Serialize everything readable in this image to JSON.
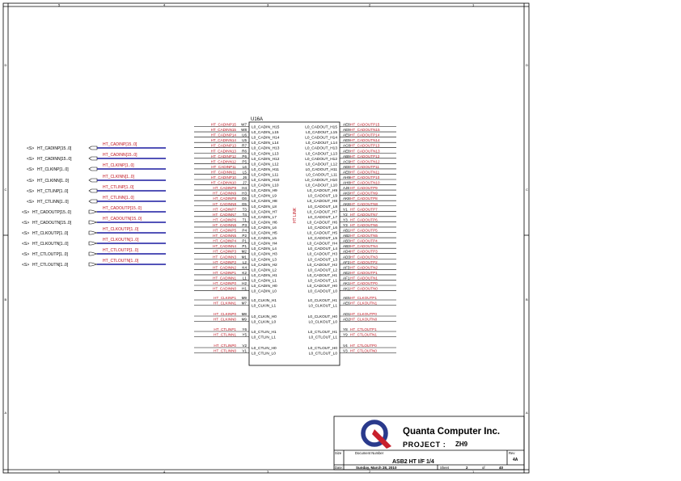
{
  "border": {
    "top_cols": [
      "5",
      "4",
      "3",
      "2",
      "1"
    ],
    "side_rows": [
      "D",
      "C",
      "B",
      "A"
    ]
  },
  "title_block": {
    "company": "Quanta Computer Inc.",
    "project_label": "PROJECT :",
    "project_value": "ZH9",
    "size_label": "Size",
    "docnum_label": "Document Number",
    "rev_label": "Rev",
    "docnum": "ASB2 HT I/F 1/4",
    "rev": "4A",
    "date_label": "Date:",
    "date": "Sunday, March 28, 2010",
    "sheet_label": "Sheet",
    "sheet": "2",
    "of_label": "of",
    "total": "40"
  },
  "ports": [
    {
      "dir": "<S>",
      "name": "HT_CADINP[15..0]",
      "bus": "HT_CADINP[15..0]",
      "out": false
    },
    {
      "dir": "<S>",
      "name": "HT_CADINN[15..0]",
      "bus": "HT_CADINN[15..0]",
      "out": false
    },
    {
      "dir": "<S>",
      "name": "HT_CLKINP[1..0]",
      "bus": "HT_CLKINP[1..0]",
      "out": false
    },
    {
      "dir": "<S>",
      "name": "HT_CLKINN[1..0]",
      "bus": "HT_CLKINN[1..0]",
      "out": false
    },
    {
      "dir": "<S>",
      "name": "HT_CTLINP[1..0]",
      "bus": "HT_CTLINP[1..0]",
      "out": false
    },
    {
      "dir": "<S>",
      "name": "HT_CTLINN[1..0]",
      "bus": "HT_CTLINN[1..0]",
      "out": false
    },
    {
      "dir": "<S>",
      "name": "HT_CADOUTP[15..0]",
      "bus": "HT_CADOUTP[15..0]",
      "out": true
    },
    {
      "dir": "<S>",
      "name": "HT_CADOUTN[15..0]",
      "bus": "HT_CADOUTN[15..0]",
      "out": true
    },
    {
      "dir": "<S>",
      "name": "HT_CLKOUTP[1..0]",
      "bus": "HT_CLKOUTP[1..0]",
      "out": true
    },
    {
      "dir": "<S>",
      "name": "HT_CLKOUTN[1..0]",
      "bus": "HT_CLKOUTN[1..0]",
      "out": true
    },
    {
      "dir": "<S>",
      "name": "HT_CTLOUTP[1..0]",
      "bus": "HT_CTLOUTP[1..0]",
      "out": true
    },
    {
      "dir": "<S>",
      "name": "HT_CTLOUTN[1..0]",
      "bus": "HT_CTLOUTN[1..0]",
      "out": true
    }
  ],
  "chip": {
    "ref": "U16A",
    "center_label": "HT LINK",
    "left_cad": [
      {
        "net": "HT_CADINP15",
        "pin": "W7",
        "label": "L0_CADIN_H15"
      },
      {
        "net": "HT_CADINN15",
        "pin": "W8",
        "label": "L0_CADIN_L15"
      },
      {
        "net": "HT_CADINP14",
        "pin": "U6",
        "label": "L0_CADIN_H14"
      },
      {
        "net": "HT_CADINN14",
        "pin": "U5",
        "label": "L0_CADIN_L14"
      },
      {
        "net": "HT_CADINP13",
        "pin": "R7",
        "label": "L0_CADIN_H13"
      },
      {
        "net": "HT_CADINN13",
        "pin": "R6",
        "label": "L0_CADIN_L13"
      },
      {
        "net": "HT_CADINP12",
        "pin": "P6",
        "label": "L0_CADIN_H12"
      },
      {
        "net": "HT_CADINN12",
        "pin": "P5",
        "label": "L0_CADIN_L12"
      },
      {
        "net": "HT_CADINP11",
        "pin": "L6",
        "label": "L0_CADIN_H11"
      },
      {
        "net": "HT_CADINN11",
        "pin": "L5",
        "label": "L0_CADIN_L11"
      },
      {
        "net": "HT_CADINP10",
        "pin": "J6",
        "label": "L0_CADIN_H10"
      },
      {
        "net": "HT_CADINN10",
        "pin": "J7",
        "label": "L0_CADIN_L10"
      },
      {
        "net": "HT_CADINP9",
        "pin": "H4",
        "label": "L0_CADIN_H9"
      },
      {
        "net": "HT_CADINN9",
        "pin": "H3",
        "label": "L0_CADIN_L9"
      },
      {
        "net": "HT_CADINP8",
        "pin": "G6",
        "label": "L0_CADIN_H8"
      },
      {
        "net": "HT_CADINN8",
        "pin": "G5",
        "label": "L0_CADIN_L8"
      },
      {
        "net": "HT_CADINP7",
        "pin": "T3",
        "label": "L0_CADIN_H7"
      },
      {
        "net": "HT_CADINN7",
        "pin": "T4",
        "label": "L0_CADIN_L7"
      },
      {
        "net": "HT_CADINP6",
        "pin": "T1",
        "label": "L0_CADIN_H6"
      },
      {
        "net": "HT_CADINN6",
        "pin": "P3",
        "label": "L0_CADIN_L6"
      },
      {
        "net": "HT_CADINP5",
        "pin": "P4",
        "label": "L0_CADIN_H5"
      },
      {
        "net": "HT_CADINN5",
        "pin": "P2",
        "label": "L0_CADIN_L5"
      },
      {
        "net": "HT_CADINP4",
        "pin": "P1",
        "label": "L0_CADIN_H4"
      },
      {
        "net": "HT_CADINN4",
        "pin": "P1",
        "label": "L0_CADIN_L4"
      },
      {
        "net": "HT_CADINP3",
        "pin": "M2",
        "label": "L0_CADIN_H3"
      },
      {
        "net": "HT_CADINN3",
        "pin": "M1",
        "label": "L0_CADIN_L3"
      },
      {
        "net": "HT_CADINP2",
        "pin": "L2",
        "label": "L0_CADIN_H2"
      },
      {
        "net": "HT_CADINN2",
        "pin": "K4",
        "label": "L0_CADIN_L2"
      },
      {
        "net": "HT_CADINP1",
        "pin": "K2",
        "label": "L0_CADIN_H1"
      },
      {
        "net": "HT_CADINN1",
        "pin": "L1",
        "label": "L0_CADIN_L1"
      },
      {
        "net": "HT_CADINP0",
        "pin": "H2",
        "label": "L0_CADIN_H0"
      },
      {
        "net": "HT_CADINN0",
        "pin": "H1",
        "label": "L0_CADIN_L0"
      }
    ],
    "right_cad": [
      {
        "net": "HT_CADOUTP15",
        "pin": "AE8",
        "label": "L0_CADOUT_H15"
      },
      {
        "net": "HT_CADOUTN15",
        "pin": "AE9",
        "label": "L0_CADOUT_L15"
      },
      {
        "net": "HT_CADOUTP14",
        "pin": "AE9",
        "label": "L0_CADOUT_H14"
      },
      {
        "net": "HT_CADOUTN14",
        "pin": "AE9",
        "label": "L0_CADOUT_L14"
      },
      {
        "net": "HT_CADOUTP13",
        "pin": "AC8",
        "label": "L0_CADOUT_H13"
      },
      {
        "net": "HT_CADOUTN13",
        "pin": "AE8",
        "label": "L0_CADOUT_L13"
      },
      {
        "net": "HT_CADOUTP12",
        "pin": "AB9",
        "label": "L0_CADOUT_H12"
      },
      {
        "net": "HT_CADOUTN12",
        "pin": "AC9",
        "label": "L0_CADOUT_L12"
      },
      {
        "net": "HT_CADOUTP11",
        "pin": "AE8",
        "label": "L0_CADOUT_H11"
      },
      {
        "net": "HT_CADOUTN11",
        "pin": "AE8",
        "label": "L0_CADOUT_L11"
      },
      {
        "net": "HT_CADOUTP10",
        "pin": "AH9",
        "label": "L0_CADOUT_H10"
      },
      {
        "net": "HT_CADOUTN10",
        "pin": "AH8",
        "label": "L0_CADOUT_L10"
      },
      {
        "net": "HT_CADOUTP9",
        "pin": "AJ8",
        "label": "L0_CADOUT_H9"
      },
      {
        "net": "HT_CADOUTN9",
        "pin": "AK9",
        "label": "L0_CADOUT_L9"
      },
      {
        "net": "HT_CADOUTP8",
        "pin": "AK8",
        "label": "L0_CADOUT_H8"
      },
      {
        "net": "HT_CADOUTN8",
        "pin": "AK8",
        "label": "L0_CADOUT_L8"
      },
      {
        "net": "HT_CADOUTP7",
        "pin": "V1",
        "label": "L0_CADOUT_H7"
      },
      {
        "net": "HT_CADOUTN7",
        "pin": "Y2",
        "label": "L0_CADOUT_L7"
      },
      {
        "net": "HT_CADOUTP6",
        "pin": "Y3",
        "label": "L0_CADOUT_H6"
      },
      {
        "net": "HT_CADOUTN6",
        "pin": "Y3",
        "label": "L0_CADOUT_L6"
      },
      {
        "net": "HT_CADOUTP5",
        "pin": "AB1",
        "label": "L0_CADOUT_H5"
      },
      {
        "net": "HT_CADOUTN5",
        "pin": "AB2",
        "label": "L0_CADOUT_L5"
      },
      {
        "net": "HT_CADOUTP4",
        "pin": "AB3",
        "label": "L0_CADOUT_H4"
      },
      {
        "net": "HT_CADOUTN4",
        "pin": "AB3",
        "label": "L0_CADOUT_L4"
      },
      {
        "net": "HT_CADOUTP3",
        "pin": "AD4",
        "label": "L0_CADOUT_H3"
      },
      {
        "net": "HT_CADOUTN3",
        "pin": "AD3",
        "label": "L0_CADOUT_L3"
      },
      {
        "net": "HT_CADOUTP2",
        "pin": "AF2",
        "label": "L0_CADOUT_H2"
      },
      {
        "net": "HT_CADOUTN2",
        "pin": "AF3",
        "label": "L0_CADOUT_L2"
      },
      {
        "net": "HT_CADOUTP1",
        "pin": "AE2",
        "label": "L0_CADOUT_H1"
      },
      {
        "net": "HT_CADOUTN1",
        "pin": "AF1",
        "label": "L0_CADOUT_L1"
      },
      {
        "net": "HT_CADOUTP0",
        "pin": "AK1",
        "label": "L0_CADOUT_H0"
      },
      {
        "net": "HT_CADOUTN0",
        "pin": "AK1",
        "label": "L0_CADOUT_L0"
      }
    ],
    "left_misc": [
      {
        "net": "HT_CLKINP1",
        "pin": "M9",
        "label": "L0_CLKIN_H1",
        "group": 0
      },
      {
        "net": "HT_CLKINN1",
        "pin": "M7",
        "label": "L0_CLKIN_L1",
        "group": 0
      },
      {
        "net": "HT_CLKINP0",
        "pin": "M8",
        "label": "L0_CLKIN_H0",
        "group": 1
      },
      {
        "net": "HT_CLKINN0",
        "pin": "M9",
        "label": "L0_CLKIN_L0",
        "group": 1
      },
      {
        "net": "HT_CTLINP1",
        "pin": "Y6",
        "label": "L0_CTLIN_H1",
        "group": 2
      },
      {
        "net": "HT_CTLINN1",
        "pin": "Y5",
        "label": "L0_CTLIN_L1",
        "group": 2
      },
      {
        "net": "HT_CTLINP0",
        "pin": "V2",
        "label": "L0_CTLIN_H0",
        "group": 3
      },
      {
        "net": "HT_CTLINN0",
        "pin": "V1",
        "label": "L0_CTLIN_L0",
        "group": 3
      }
    ],
    "right_misc": [
      {
        "net": "HT_CLKOUTP1",
        "pin": "AE5",
        "label": "L0_CLKOUT_H1",
        "group": 0
      },
      {
        "net": "HT_CLKOUTN1",
        "pin": "AE6",
        "label": "L0_CLKOUT_L1",
        "group": 0
      },
      {
        "net": "HT_CLKOUTP0",
        "pin": "AD1",
        "label": "L0_CLKOUT_H0",
        "group": 1
      },
      {
        "net": "HT_CLKOUTN0",
        "pin": "AD2",
        "label": "L0_CLKOUT_L0",
        "group": 1
      },
      {
        "net": "HT_CTLOUTP1",
        "pin": "Y8",
        "label": "L0_CTLOUT_H1",
        "group": 2
      },
      {
        "net": "HT_CTLOUTN1",
        "pin": "Y9",
        "label": "L0_CTLOUT_L1",
        "group": 2
      },
      {
        "net": "HT_CTLOUTP0",
        "pin": "V4",
        "label": "L0_CTLOUT_H0",
        "group": 3
      },
      {
        "net": "HT_CTLOUTN0",
        "pin": "V3",
        "label": "L0_CTLOUT_L0",
        "group": 3
      }
    ]
  },
  "colors": {
    "net": "#c0101c",
    "bus": "#1a1aa0",
    "line": "#000000",
    "logo_blue": "#2a3a8c",
    "logo_red": "#c8202c"
  }
}
